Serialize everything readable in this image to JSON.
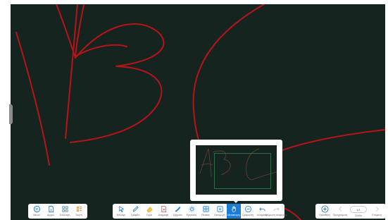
{
  "colors": {
    "board": "#162420",
    "ink": "#b81418",
    "accent": "#1b7ed6",
    "navigator_frame": "#2d6e49"
  },
  "left_toolbar": [
    {
      "label": "Μενού",
      "icon": "menu-icon"
    },
    {
      "label": "Αρχείο",
      "icon": "file-icon"
    },
    {
      "label": "Εναλλαγή",
      "icon": "switch-icon"
    },
    {
      "label": "Σκηνή",
      "icon": "scene-icon"
    }
  ],
  "center_toolbar": [
    {
      "label": "Επιλογή",
      "icon": "select-arrow-icon"
    },
    {
      "label": "Γραφίδα",
      "icon": "pen-icon"
    },
    {
      "label": "Γόμα",
      "icon": "eraser-icon"
    },
    {
      "label": "Διαγραφή",
      "icon": "clear-icon"
    },
    {
      "label": "Σχήματα",
      "icon": "shapes-icon"
    },
    {
      "label": "Εργαλεία",
      "icon": "tools-gear-icon"
    },
    {
      "label": "Πίνακας",
      "icon": "table-icon"
    },
    {
      "label": "Εισαγωγή",
      "icon": "insert-icon"
    },
    {
      "label": "Μετακίνηση",
      "icon": "pan-hand-icon",
      "active": true
    },
    {
      "label": "Σμίκρυνση",
      "icon": "zoom-out-icon"
    },
    {
      "label": "Αναίρεση",
      "icon": "undo-icon"
    },
    {
      "label": "Ακύρωση αναίρεσης",
      "icon": "redo-icon"
    }
  ],
  "right_toolbar": {
    "add_page_label": "Προσθήκη",
    "prev_label": "Προηγούμενη",
    "page_indicator": "1/1",
    "page_label": "Σελίδα",
    "next_label": "Επόμενη"
  }
}
